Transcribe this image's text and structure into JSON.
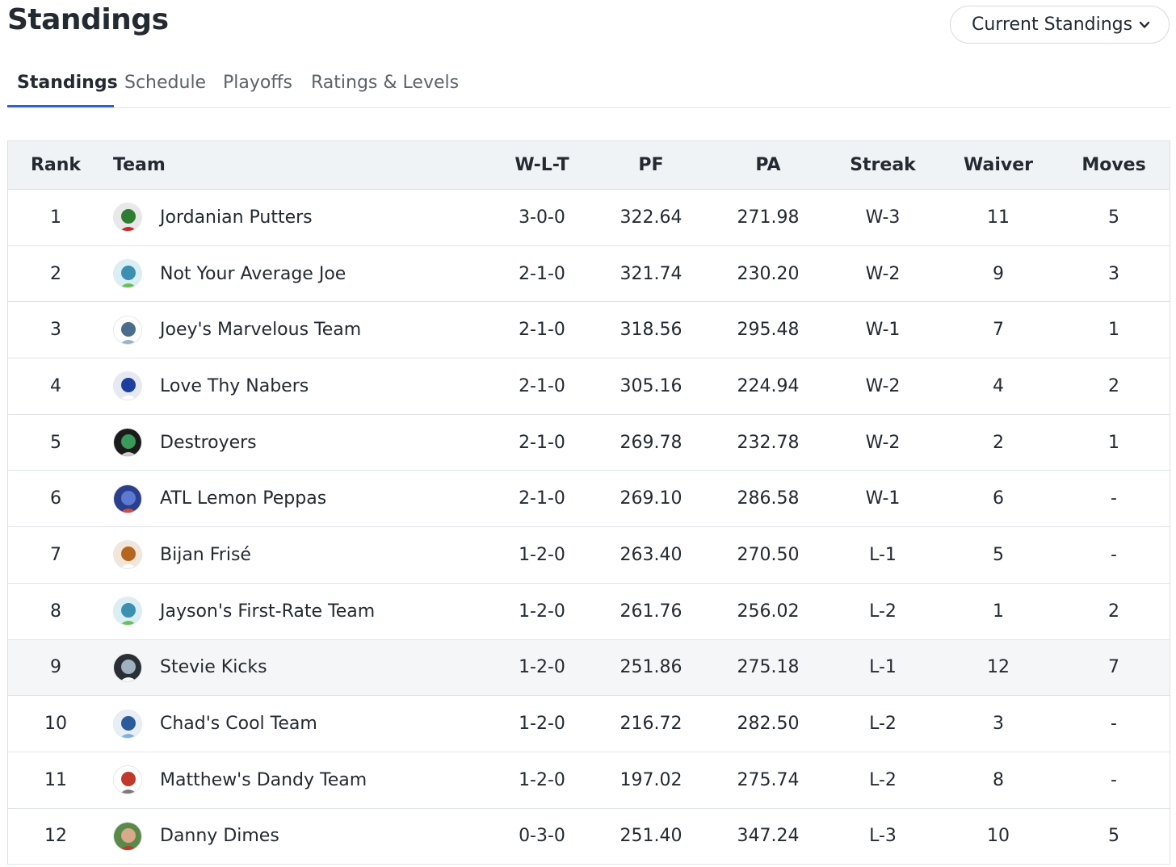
{
  "header": {
    "title": "Standings",
    "view_select": "Current Standings"
  },
  "tabs": [
    {
      "label": "Standings",
      "active": true
    },
    {
      "label": "Schedule",
      "active": false
    },
    {
      "label": "Playoffs",
      "active": false
    },
    {
      "label": "Ratings & Levels",
      "active": false
    }
  ],
  "table": {
    "columns": [
      "Rank",
      "Team",
      "W-L-T",
      "PF",
      "PA",
      "Streak",
      "Waiver",
      "Moves"
    ],
    "rows": [
      {
        "rank": "1",
        "team": "Jordanian Putters",
        "wlt": "3-0-0",
        "pf": "322.64",
        "pa": "271.98",
        "streak": "W-3",
        "waiver": "11",
        "moves": "5",
        "avatar": {
          "icon": "golfer-flag-avatar",
          "bg": "#e8e8e8",
          "fg": "#2f7d32",
          "accent": "#c62828"
        }
      },
      {
        "rank": "2",
        "team": "Not Your Average Joe",
        "wlt": "2-1-0",
        "pf": "321.74",
        "pa": "230.20",
        "streak": "W-2",
        "waiver": "9",
        "moves": "3",
        "avatar": {
          "icon": "mascot-avatar",
          "bg": "#d9eef5",
          "fg": "#3b8fb0",
          "accent": "#6cbf5a"
        }
      },
      {
        "rank": "3",
        "team": "Joey's Marvelous Team",
        "wlt": "2-1-0",
        "pf": "318.56",
        "pa": "295.48",
        "streak": "W-1",
        "waiver": "7",
        "moves": "1",
        "avatar": {
          "icon": "shark-avatar",
          "bg": "#ffffff",
          "fg": "#4a6d8c",
          "accent": "#9bb3c7"
        }
      },
      {
        "rank": "4",
        "team": "Love Thy Nabers",
        "wlt": "2-1-0",
        "pf": "305.16",
        "pa": "224.94",
        "streak": "W-2",
        "waiver": "4",
        "moves": "2",
        "avatar": {
          "icon": "player-jersey-avatar",
          "bg": "#e6e9f2",
          "fg": "#1e3fa0",
          "accent": "#ffffff"
        }
      },
      {
        "rank": "5",
        "team": "Destroyers",
        "wlt": "2-1-0",
        "pf": "269.78",
        "pa": "232.78",
        "streak": "W-2",
        "waiver": "2",
        "moves": "1",
        "avatar": {
          "icon": "skull-avatar",
          "bg": "#1b1b1b",
          "fg": "#3a9a5b",
          "accent": "#cfcfcf"
        }
      },
      {
        "rank": "6",
        "team": "ATL Lemon Peppas",
        "wlt": "2-1-0",
        "pf": "269.10",
        "pa": "286.58",
        "streak": "W-1",
        "waiver": "6",
        "moves": "-",
        "avatar": {
          "icon": "city-skyline-avatar",
          "bg": "#2b3f8c",
          "fg": "#5a7bd1",
          "accent": "#d94b3a"
        }
      },
      {
        "rank": "7",
        "team": "Bijan Frisé",
        "wlt": "1-2-0",
        "pf": "263.40",
        "pa": "270.50",
        "streak": "L-1",
        "waiver": "5",
        "moves": "-",
        "avatar": {
          "icon": "dog-avatar",
          "bg": "#f2e6da",
          "fg": "#b5651d",
          "accent": "#ffffff"
        }
      },
      {
        "rank": "8",
        "team": "Jayson's First-Rate Team",
        "wlt": "1-2-0",
        "pf": "261.76",
        "pa": "256.02",
        "streak": "L-2",
        "waiver": "1",
        "moves": "2",
        "avatar": {
          "icon": "mascot-avatar",
          "bg": "#d9eef5",
          "fg": "#3b8fb0",
          "accent": "#6cbf5a"
        }
      },
      {
        "rank": "9",
        "team": "Stevie Kicks",
        "wlt": "1-2-0",
        "pf": "251.86",
        "pa": "275.18",
        "streak": "L-1",
        "waiver": "12",
        "moves": "7",
        "avatar": {
          "icon": "kicks-logo-avatar",
          "bg": "#2a2f36",
          "fg": "#9fb0c0",
          "accent": "#ffffff"
        }
      },
      {
        "rank": "10",
        "team": "Chad's Cool Team",
        "wlt": "1-2-0",
        "pf": "216.72",
        "pa": "282.50",
        "streak": "L-2",
        "waiver": "3",
        "moves": "-",
        "avatar": {
          "icon": "cartoon-face-avatar",
          "bg": "#e8eef6",
          "fg": "#2a5b9a",
          "accent": "#7fb0e0"
        }
      },
      {
        "rank": "11",
        "team": "Matthew's Dandy Team",
        "wlt": "1-2-0",
        "pf": "197.02",
        "pa": "275.74",
        "streak": "L-2",
        "waiver": "8",
        "moves": "-",
        "avatar": {
          "icon": "helmet-logo-avatar",
          "bg": "#ffffff",
          "fg": "#c0392b",
          "accent": "#7a7a7a"
        }
      },
      {
        "rank": "12",
        "team": "Danny Dimes",
        "wlt": "0-3-0",
        "pf": "251.40",
        "pa": "347.24",
        "streak": "L-3",
        "waiver": "10",
        "moves": "5",
        "avatar": {
          "icon": "player-photo-avatar",
          "bg": "#5a8a4a",
          "fg": "#d8a98a",
          "accent": "#c0392b"
        }
      }
    ],
    "highlighted_row_index": 8
  },
  "colors": {
    "accent": "#2d5fd7",
    "header_bg": "#f0f3f5",
    "text": "#232a31",
    "muted": "#5b636a"
  }
}
